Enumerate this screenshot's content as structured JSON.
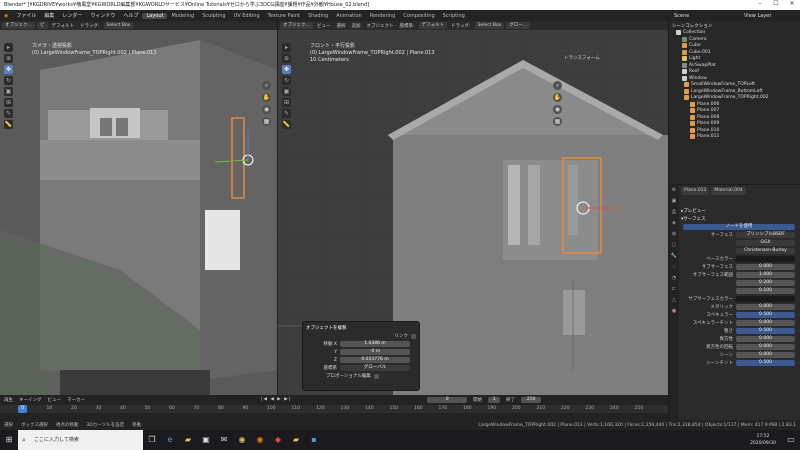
{
  "window": {
    "title": "Blender* [¥KGDRIVE¥works¥楠風堂¥KGWORLD編集部¥KGWORLDサービス¥Online Tutorials¥ゼロから学ぶ3DCG講座¥課題¥作品¥外観¥House_02.blend]"
  },
  "menubar": {
    "menus": [
      "ファイル",
      "編集",
      "レンダー",
      "ウィンドウ",
      "ヘルプ"
    ],
    "workspaces": [
      "Layout",
      "Modeling",
      "Sculpting",
      "UV Editing",
      "Texture Paint",
      "Shading",
      "Animation",
      "Rendering",
      "Compositing",
      "Scripting"
    ],
    "active_workspace": "Layout",
    "scene": "Scene",
    "view_layer": "View Layer"
  },
  "left_viewport": {
    "header": {
      "mode": "オブジェク…",
      "view": "ビ",
      "orientation": "デフォルト",
      "drag": "ドラッグ:",
      "select": "Select Box"
    },
    "overlay_line1": "カメラ・透視投影",
    "overlay_line2": "(0) LargeWindowFrame_TOPRight.002 | Plane.013"
  },
  "right_viewport": {
    "header": {
      "mode": "オブジェク…",
      "view": "ビュー",
      "select": "選択",
      "add": "追加",
      "object": "オブジェクト",
      "orientation": "座標系:",
      "orientation_value": "デフォルト",
      "drag": "ドラッグ:",
      "select_box": "Select Box",
      "global": "グロー…"
    },
    "overlay_line1": "フロント・平行投影",
    "overlay_line2": "(0) LargeWindowFrame_TOPRight.002 | Plane.013",
    "overlay_line3": "10 Centimeters",
    "transform_tab": "トランスフォーム"
  },
  "op_panel": {
    "title": "オブジェクトを複製",
    "link_label": "リンク",
    "move_label": "移動 X",
    "move_x": "1.0386 m",
    "y_label": "Y",
    "move_y": "-0 m",
    "z_label": "Z",
    "move_z": "0.033776 m",
    "orient_label": "座標系",
    "orient_value": "グローバル",
    "proportional": "プロポーショナル編集"
  },
  "outliner": {
    "title": "シーンコレクション",
    "items": [
      {
        "label": "Collection",
        "color": "#cfcfcf"
      },
      {
        "label": "Camera",
        "color": "#6f9a5c"
      },
      {
        "label": "Cube",
        "color": "#e49a4a"
      },
      {
        "label": "Cube.001",
        "color": "#e49a4a"
      },
      {
        "label": "Light",
        "color": "#e4c74a"
      },
      {
        "label": "AirSwapPlat",
        "color": "#888888"
      },
      {
        "label": "Roof",
        "color": "#cfcfcf"
      },
      {
        "label": "Window",
        "color": "#cfcfcf"
      },
      {
        "label": "SmallWindowFrame_TOPLeft",
        "color": "#e49a4a"
      },
      {
        "label": "LargeWindowFrame_BottomLeft",
        "color": "#e49a4a"
      },
      {
        "label": "LargeWindowFrame_TOPRight.002",
        "color": "#e49a4a"
      },
      {
        "label": "Plane.006",
        "color": "#e49a4a"
      },
      {
        "label": "Plane.007",
        "color": "#e49a4a"
      },
      {
        "label": "Plane.008",
        "color": "#e49a4a"
      },
      {
        "label": "Plane.009",
        "color": "#e49a4a"
      },
      {
        "label": "Plane.010",
        "color": "#e49a4a"
      },
      {
        "label": "Plane.011",
        "color": "#e49a4a"
      }
    ]
  },
  "properties": {
    "object_tab": "Plane.013",
    "material_tab": "Material.004",
    "preview": "プレビュー",
    "surface": "サーフェス",
    "use_nodes": "ノードを使用",
    "surface_label": "サーフェス",
    "surface_value": "プリンシプルBSDF",
    "distribution": "GGX",
    "subsurface_method": "Christensen-Burley",
    "rows": [
      {
        "label": "ベースカラー",
        "value": "",
        "style": "dark"
      },
      {
        "label": "サブサーフェス",
        "value": "0.000",
        "style": ""
      },
      {
        "label": "サブサーフェス範囲",
        "value": "1.000",
        "style": ""
      },
      {
        "label": "",
        "value": "0.200",
        "style": ""
      },
      {
        "label": "",
        "value": "0.100",
        "style": ""
      },
      {
        "label": "サブサーフェスカラー",
        "value": "",
        "style": "dark"
      },
      {
        "label": "メタリック",
        "value": "0.000",
        "style": ""
      },
      {
        "label": "スペキュラー",
        "value": "0.500",
        "style": "blue"
      },
      {
        "label": "スペキュラーチント",
        "value": "0.000",
        "style": ""
      },
      {
        "label": "粗さ",
        "value": "0.500",
        "style": "blue"
      },
      {
        "label": "異方性",
        "value": "0.000",
        "style": ""
      },
      {
        "label": "異方性の回転",
        "value": "0.000",
        "style": ""
      },
      {
        "label": "シーン",
        "value": "0.000",
        "style": ""
      },
      {
        "label": "シーンチント",
        "value": "0.500",
        "style": "blue"
      }
    ]
  },
  "timeline": {
    "menus": [
      "再生",
      "キーイング",
      "ビュー",
      "マーカー"
    ],
    "frame_current": "0",
    "start_label": "開始",
    "start": "1",
    "end_label": "終了",
    "end": "250",
    "ticks": [
      "0",
      "10",
      "20",
      "30",
      "40",
      "50",
      "60",
      "70",
      "80",
      "90",
      "100",
      "110",
      "120",
      "130",
      "140",
      "150",
      "160",
      "170",
      "180",
      "190",
      "200",
      "210",
      "220",
      "230",
      "240",
      "250"
    ],
    "playhead": "0"
  },
  "statusbar": {
    "select": "選択",
    "box_select": "ボックス選択",
    "pan": "視点の移動",
    "cursor": "3Dカーソルを設定",
    "move": "移動",
    "stats": "LargeWindowFrame_TOPRight.002 | Plane.013 | Verts:1,166,320 | Faces:1,159,440 | Tris:2,318,854 | Objects:1/117 | Mem: 417.9 MiB | 2.83.1"
  },
  "taskbar": {
    "search_placeholder": "ここに入力して検索",
    "time": "17:52",
    "date": "2020/09/30"
  }
}
